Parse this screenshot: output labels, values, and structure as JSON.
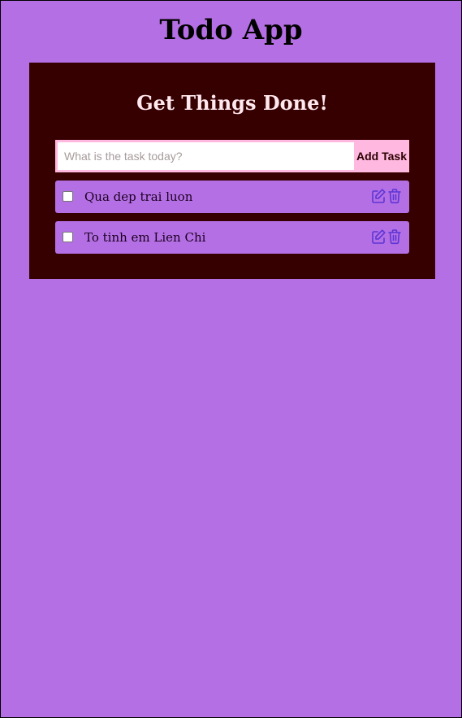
{
  "app": {
    "title": "Todo App"
  },
  "card": {
    "title": "Get Things Done!"
  },
  "form": {
    "input_value": "",
    "input_placeholder": "What is the task today?",
    "add_label": "Add Task"
  },
  "tasks": [
    {
      "text": "Qua dep trai luon",
      "completed": false
    },
    {
      "text": "To tinh em Lien Chi",
      "completed": false
    }
  ],
  "icons": {
    "edit": "edit-icon",
    "delete": "trash-icon"
  },
  "colors": {
    "background": "#b56fe4",
    "card": "#370000",
    "accent": "#ffb8df",
    "icon": "#5b35d5"
  }
}
